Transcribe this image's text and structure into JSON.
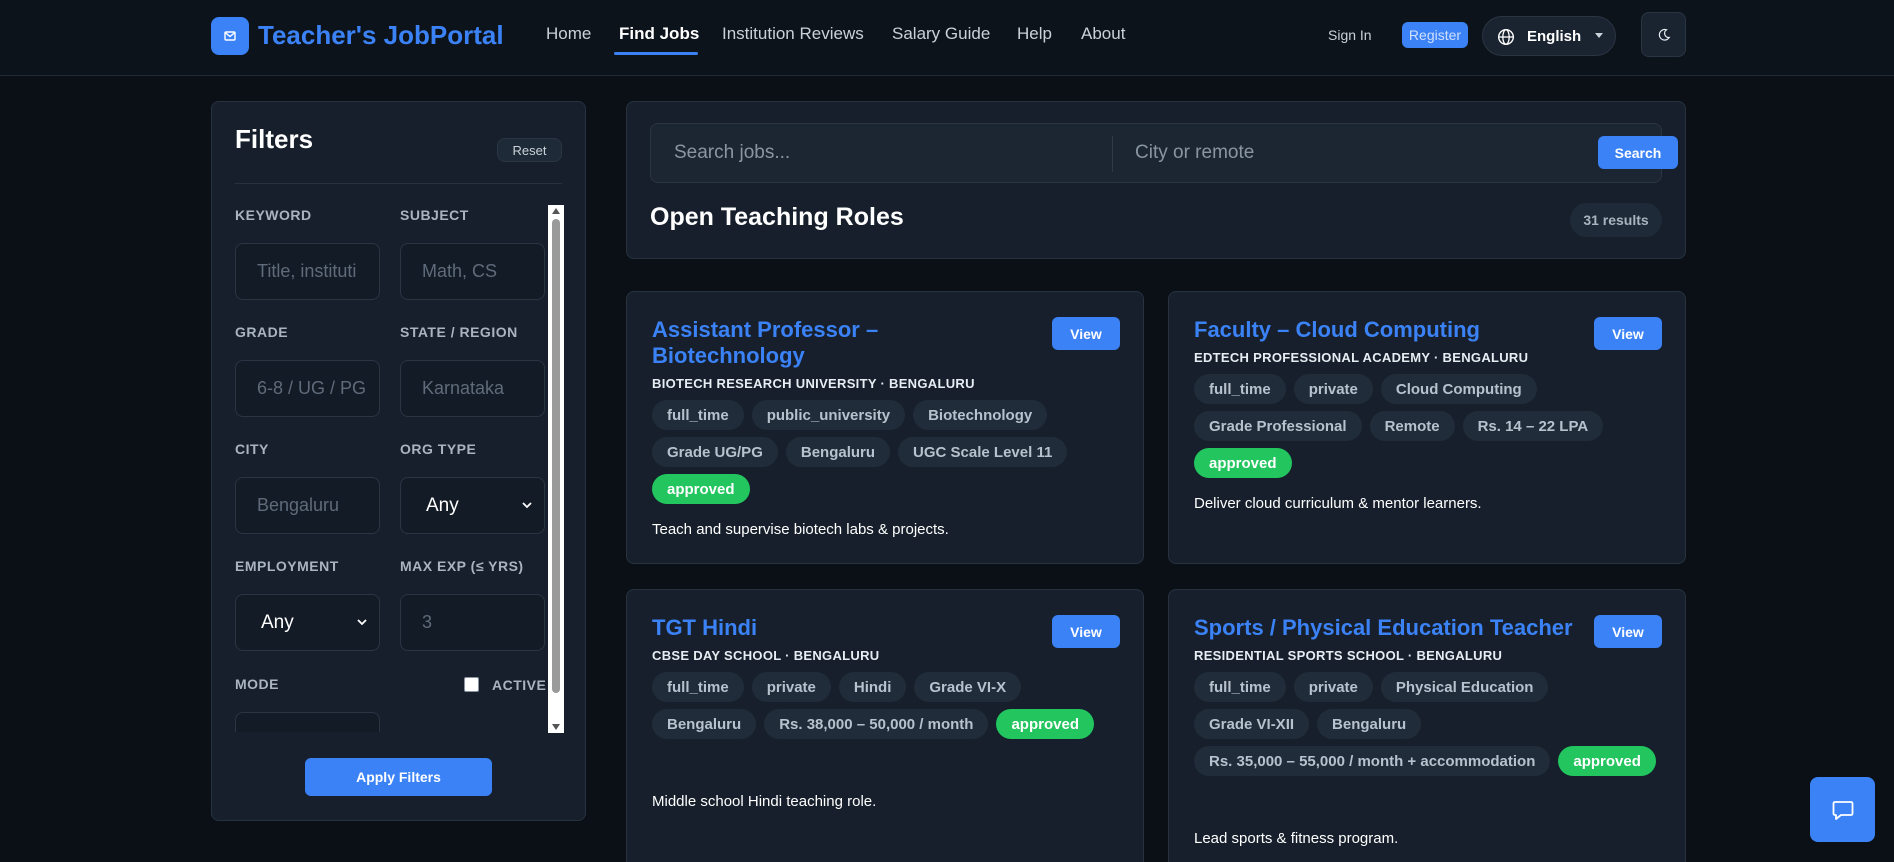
{
  "header": {
    "brand": "Teacher's JobPortal",
    "nav": {
      "home": "Home",
      "find_jobs": "Find Jobs",
      "institution_reviews": "Institution Reviews",
      "salary_guide": "Salary Guide",
      "help": "Help",
      "about": "About"
    },
    "sign_in": "Sign In",
    "register": "Register",
    "language": "English"
  },
  "filters": {
    "title": "Filters",
    "reset": "Reset",
    "fields": {
      "keyword": {
        "label": "KEYWORD",
        "placeholder": "Title, instituti"
      },
      "subject": {
        "label": "SUBJECT",
        "placeholder": "Math, CS"
      },
      "grade": {
        "label": "GRADE",
        "placeholder": "6-8 / UG / PG"
      },
      "state": {
        "label": "STATE / REGION",
        "placeholder": "Karnataka"
      },
      "city": {
        "label": "CITY",
        "placeholder": "Bengaluru"
      },
      "org_type": {
        "label": "ORG TYPE",
        "value": "Any"
      },
      "employment": {
        "label": "EMPLOYMENT",
        "value": "Any"
      },
      "max_exp": {
        "label": "MAX EXP (≤ YRS)",
        "placeholder": "3"
      },
      "mode": {
        "label": "MODE"
      },
      "active": {
        "label": "ACTIVE"
      }
    },
    "apply": "Apply Filters"
  },
  "search": {
    "jobs_placeholder": "Search jobs...",
    "city_placeholder": "City or remote",
    "button": "Search",
    "section_title": "Open Teaching Roles",
    "results": "31 results"
  },
  "jobs": [
    {
      "title_line1": "Assistant Professor –",
      "title_line2": "Biotechnology",
      "org": "BIOTECH RESEARCH UNIVERSITY · BENGALURU",
      "view": "View",
      "tags": [
        "full_time",
        "public_university",
        "Biotechnology",
        "Grade UG/PG",
        "Bengaluru",
        "UGC Scale Level 11"
      ],
      "status": "approved",
      "description": "Teach and supervise biotech labs & projects."
    },
    {
      "title_line1": "Faculty – Cloud Computing",
      "org": "EDTECH PROFESSIONAL ACADEMY · BENGALURU",
      "view": "View",
      "tags": [
        "full_time",
        "private",
        "Cloud Computing",
        "Grade Professional",
        "Remote",
        "Rs. 14 – 22 LPA"
      ],
      "status": "approved",
      "description": "Deliver cloud curriculum & mentor learners."
    },
    {
      "title_line1": "TGT Hindi",
      "org": "CBSE DAY SCHOOL · BENGALURU",
      "view": "View",
      "tags": [
        "full_time",
        "private",
        "Hindi",
        "Grade VI-X",
        "Bengaluru",
        "Rs. 38,000 – 50,000 / month"
      ],
      "status": "approved",
      "description": "Middle school Hindi teaching role."
    },
    {
      "title_line1": "Sports / Physical Education Teacher",
      "org": "RESIDENTIAL SPORTS SCHOOL · BENGALURU",
      "view": "View",
      "tags": [
        "full_time",
        "private",
        "Physical Education",
        "Grade VI-XII",
        "Bengaluru",
        "Rs. 35,000 – 55,000 / month + accommodation"
      ],
      "status": "approved",
      "description": "Lead sports & fitness program."
    }
  ],
  "colors": {
    "accent": "#3b82f6",
    "approved": "#22c55e",
    "background": "#0b1016",
    "panel": "#161f2b"
  },
  "icons": {
    "logo": "mail-icon",
    "language": "globe-icon",
    "theme": "moon-icon",
    "chat": "chat-icon"
  }
}
